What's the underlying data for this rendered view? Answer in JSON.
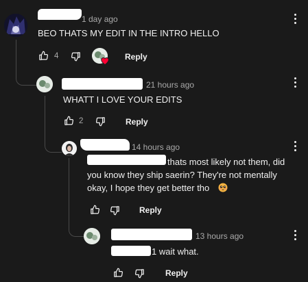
{
  "comments": [
    {
      "time": "1 day ago",
      "text": "BEO THATS MY EDIT IN THE INTRO HELLO",
      "likes": "4",
      "reply_label": "Reply"
    },
    {
      "time": "21 hours ago",
      "text": "WHATT I LOVE YOUR EDITS",
      "likes": "2",
      "reply_label": "Reply"
    },
    {
      "time": "14 hours ago",
      "text_line1": "thats most likely not them, did",
      "text_line2": "you know they ship saerin? They're not mentally",
      "text_line3": "okay, I hope they get better tho",
      "reply_label": "Reply"
    },
    {
      "time": "13 hours ago",
      "text": "1 wait what.",
      "reply_label": "Reply"
    }
  ],
  "colors": {
    "background": "#1a1a1a",
    "text": "#f1f1f1",
    "secondary": "#aaaaaa",
    "heart": "#ff0033"
  }
}
